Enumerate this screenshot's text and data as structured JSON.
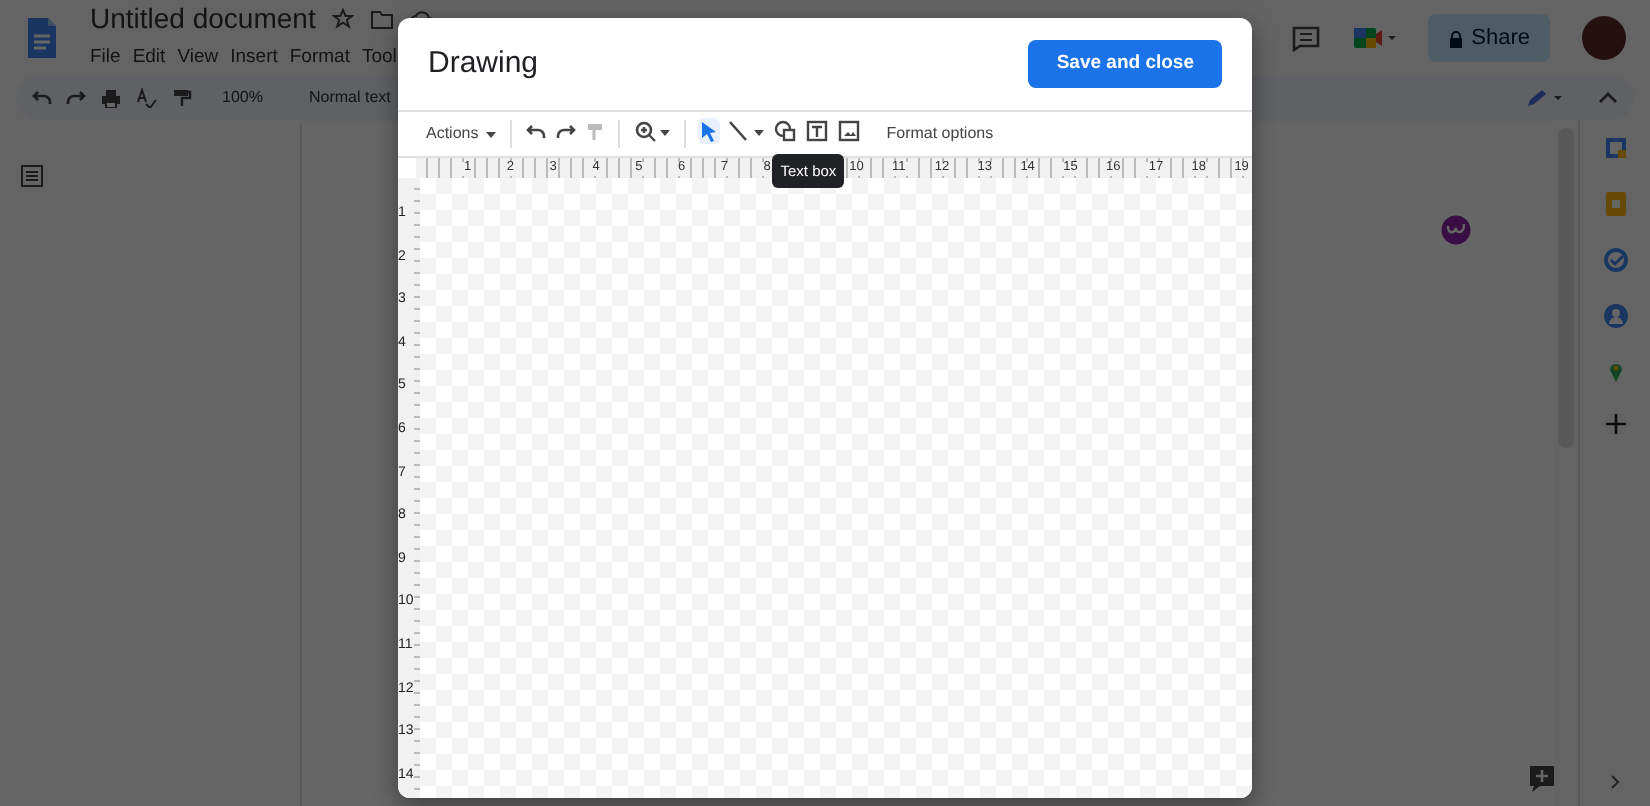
{
  "doc": {
    "title": "Untitled document",
    "menu": [
      "File",
      "Edit",
      "View",
      "Insert",
      "Format",
      "Tool"
    ],
    "share_button": "Share",
    "toolbar": {
      "zoom": "100%",
      "style": "Normal text"
    }
  },
  "dialog": {
    "title": "Drawing",
    "save_button": "Save and close",
    "toolbar": {
      "actions_menu": "Actions",
      "tools": [
        {
          "kind": "undo",
          "selected": false,
          "disabled": false
        },
        {
          "kind": "redo",
          "selected": false,
          "disabled": false
        },
        {
          "kind": "paint_format",
          "selected": false,
          "disabled": true
        },
        {
          "kind": "zoom",
          "selected": false,
          "disabled": false
        },
        {
          "kind": "select",
          "selected": true,
          "disabled": false
        },
        {
          "kind": "line",
          "selected": false,
          "disabled": false
        },
        {
          "kind": "shape",
          "selected": false,
          "disabled": false
        },
        {
          "kind": "text_box",
          "selected": false,
          "disabled": false,
          "tooltip": "Text box"
        },
        {
          "kind": "image",
          "selected": false,
          "disabled": false
        }
      ],
      "format_options": "Format options"
    },
    "ruler": {
      "horizontal": [
        "1",
        "2",
        "3",
        "4",
        "5",
        "6",
        "7",
        "8",
        "10",
        "11",
        "12",
        "13",
        "14",
        "15",
        "16",
        "17",
        "18",
        "19"
      ],
      "vertical": [
        "1",
        "2",
        "3",
        "4",
        "5",
        "6",
        "7",
        "8",
        "9",
        "10",
        "11",
        "12",
        "13",
        "14"
      ]
    }
  }
}
